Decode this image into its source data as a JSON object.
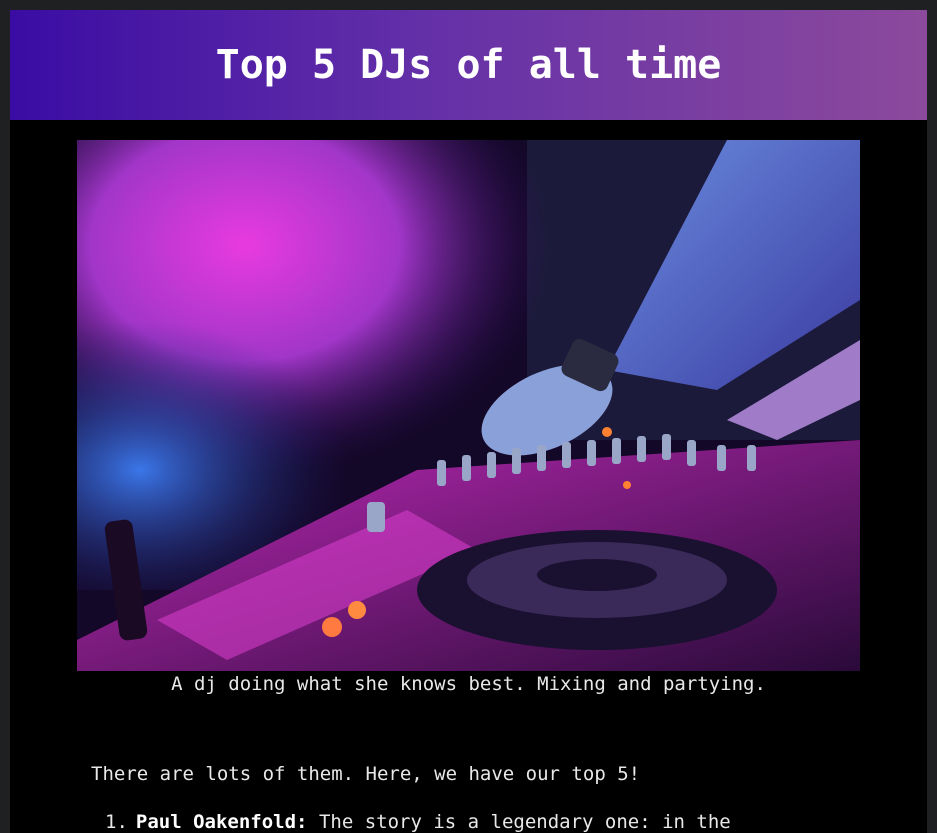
{
  "header": {
    "title": "Top 5 DJs of all time"
  },
  "figure": {
    "caption": "A dj doing what she knows best. Mixing and partying."
  },
  "intro": "There are lots of them. Here, we have our top 5!",
  "list": [
    {
      "number": "1.",
      "name": "Paul Oakenfold:",
      "text": "The story is a legendary one: in the"
    }
  ],
  "colors": {
    "header_gradient_start": "#3a0ca3",
    "header_gradient_end": "#8c4a9c",
    "background": "#000000",
    "text": "#e8e8e8"
  }
}
